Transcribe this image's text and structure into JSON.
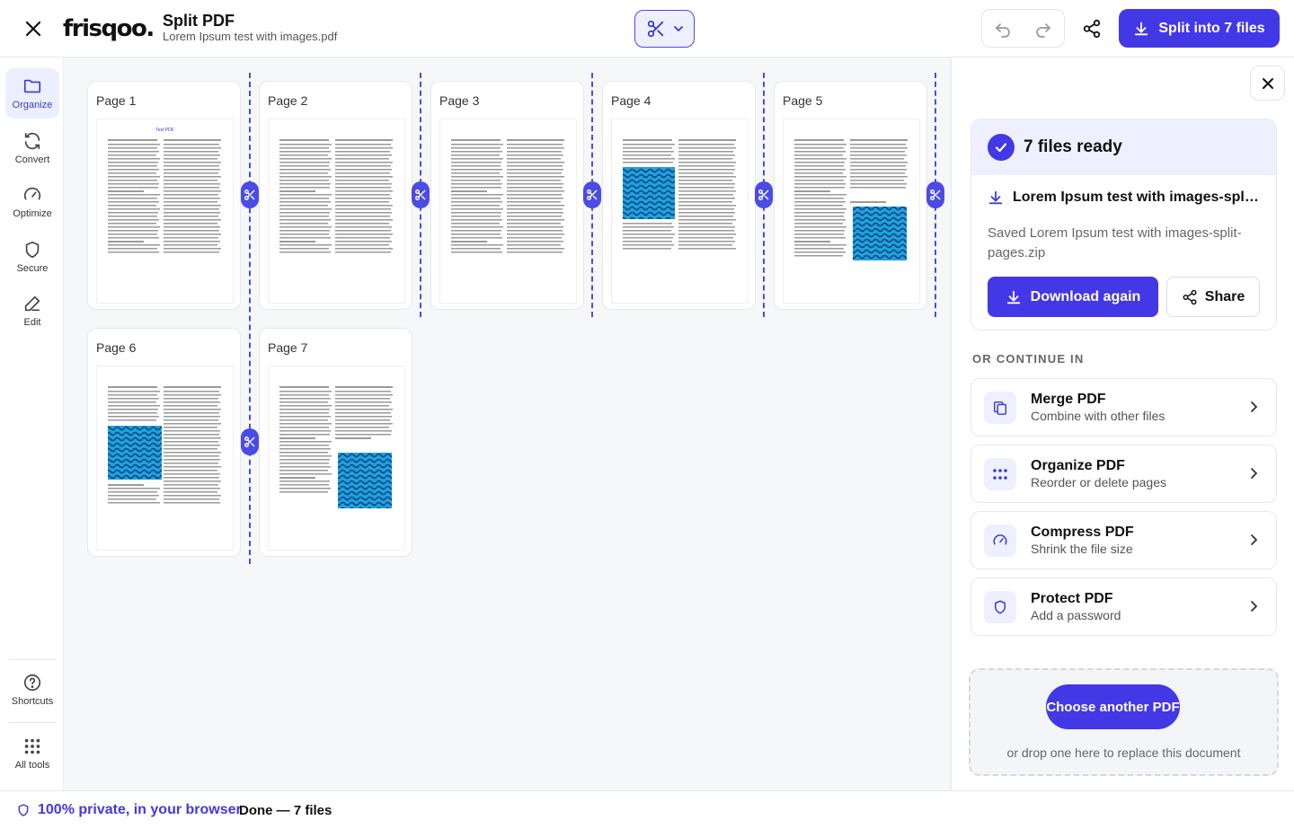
{
  "header": {
    "logo": "frisqoo.",
    "title": "Split PDF",
    "filename": "Lorem Ipsum test with images.pdf",
    "split_button": "Split into 7 files"
  },
  "rail": {
    "items": [
      {
        "label": "Organize",
        "icon": "folder-icon",
        "active": true
      },
      {
        "label": "Convert",
        "icon": "refresh-icon"
      },
      {
        "label": "Optimize",
        "icon": "gauge-icon"
      },
      {
        "label": "Secure",
        "icon": "shield-icon"
      },
      {
        "label": "Edit",
        "icon": "pencil-icon"
      }
    ],
    "bottom": [
      {
        "label": "Shortcuts",
        "icon": "help-icon"
      },
      {
        "label": "All tools",
        "icon": "grid-icon"
      }
    ]
  },
  "pages": [
    {
      "label": "Page 1",
      "thumb_title": "Test PDF"
    },
    {
      "label": "Page 2"
    },
    {
      "label": "Page 3"
    },
    {
      "label": "Page 4"
    },
    {
      "label": "Page 5"
    },
    {
      "label": "Page 6"
    },
    {
      "label": "Page 7"
    }
  ],
  "panel": {
    "ready_title": "7 files ready",
    "file_name": "Lorem Ipsum test with images-split-pages.zip",
    "saved_message": "Saved Lorem Ipsum test with images-split-pages.zip",
    "download_again": "Download again",
    "share": "Share",
    "or_continue": "OR CONTINUE IN",
    "tools": [
      {
        "name": "Merge PDF",
        "desc": "Combine with other files",
        "icon": "merge-icon"
      },
      {
        "name": "Organize PDF",
        "desc": "Reorder or delete pages",
        "icon": "dots-grid-icon"
      },
      {
        "name": "Compress PDF",
        "desc": "Shrink the file size",
        "icon": "gauge-icon"
      },
      {
        "name": "Protect PDF",
        "desc": "Add a password",
        "icon": "shield-icon"
      }
    ],
    "choose_another": "Choose another PDF",
    "drop_text": "or drop one here to replace this document"
  },
  "status": {
    "privacy": "100% private, in your browser",
    "done": "Done — 7 files"
  },
  "colors": {
    "accent": "#4338e6",
    "accent_light": "#eef0ff",
    "cut_line": "#4b4be6"
  }
}
